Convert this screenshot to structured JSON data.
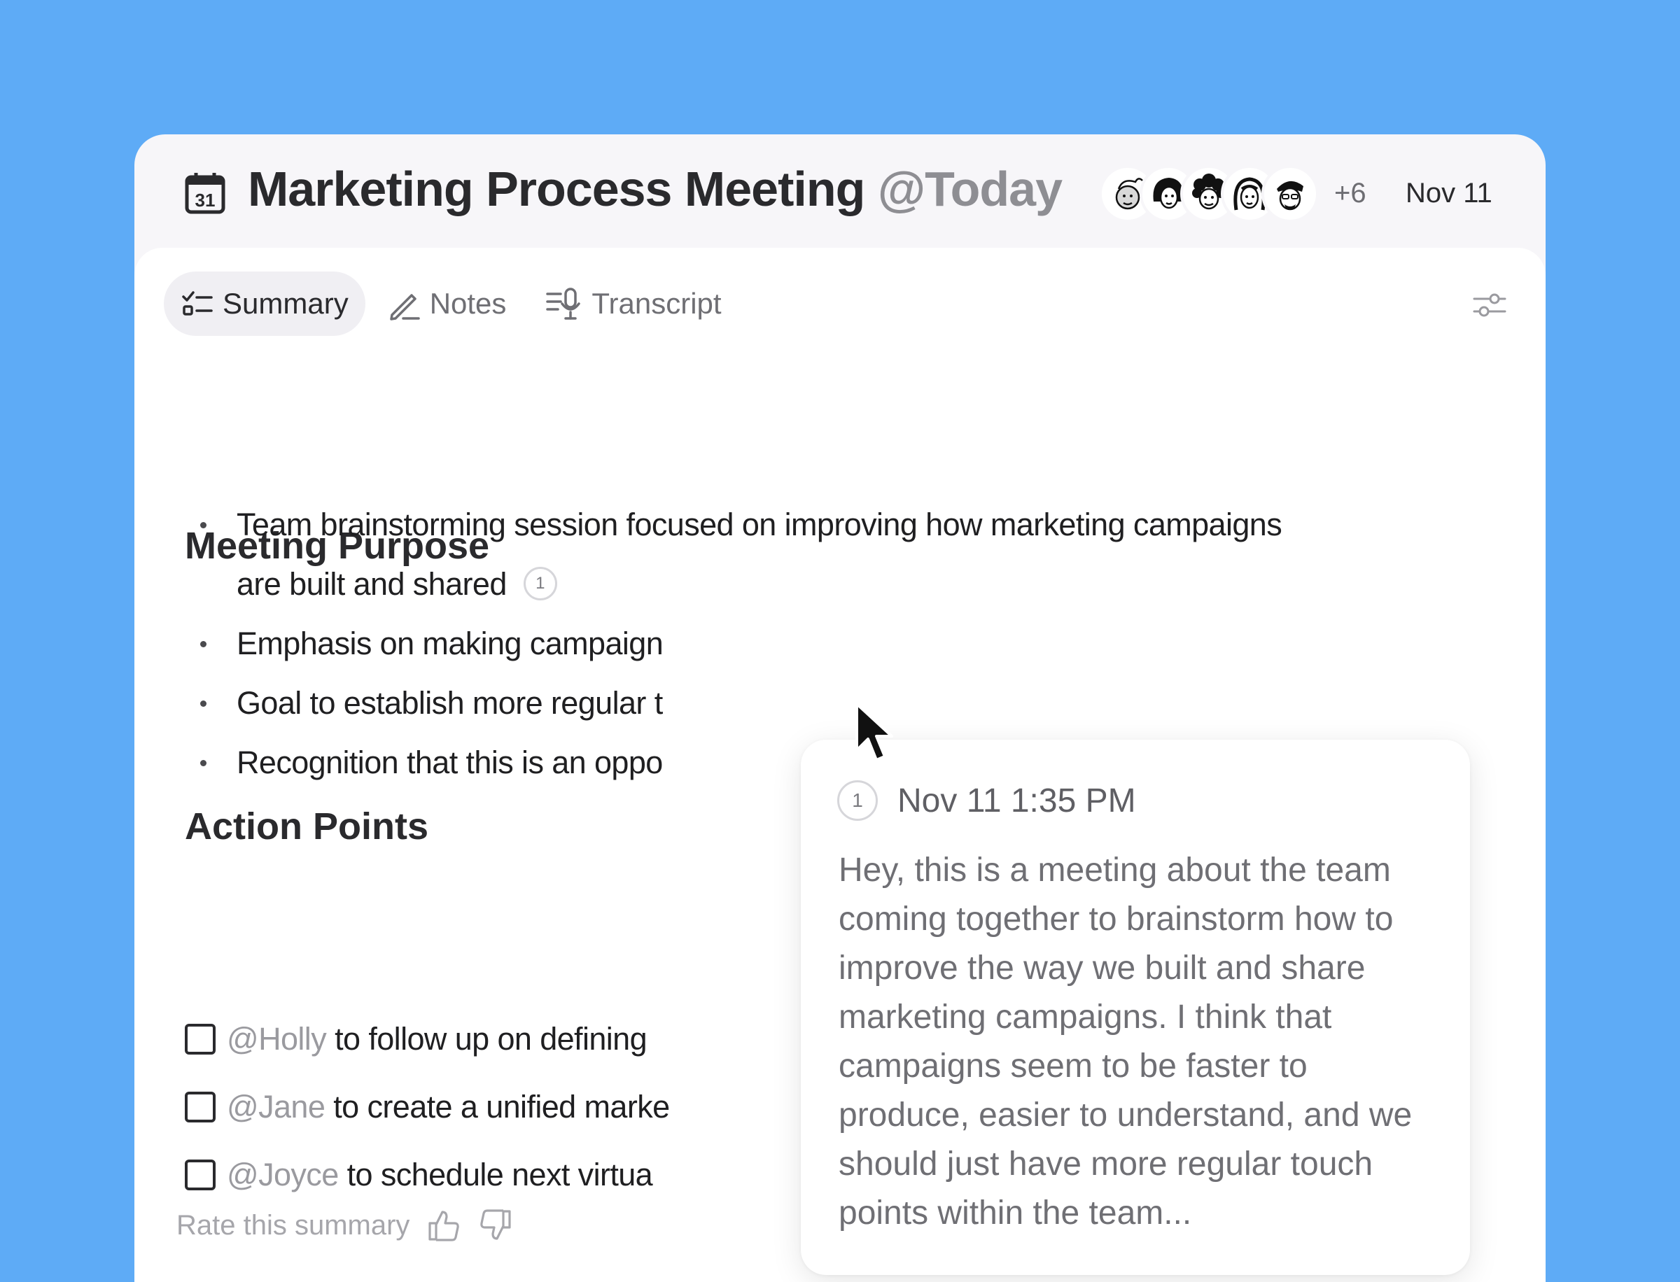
{
  "header": {
    "title": "Marketing Process Meeting",
    "title_suffix": "@Today",
    "calendar_day": "31",
    "more_participants": "+6",
    "date": "Nov 11"
  },
  "tabs": [
    {
      "label": "Summary",
      "icon": "checklist-icon",
      "active": true
    },
    {
      "label": "Notes",
      "icon": "pen-icon",
      "active": false
    },
    {
      "label": "Transcript",
      "icon": "transcript-mic-icon",
      "active": false
    }
  ],
  "purpose": {
    "heading": "Meeting Purpose",
    "items": [
      {
        "text": "Team brainstorming session focused on improving how marketing campaigns are built and shared",
        "citation": "1"
      },
      {
        "text": "Emphasis on making campaign"
      },
      {
        "text": "Goal to establish more regular t"
      },
      {
        "text": "Recognition that this is an oppo"
      }
    ]
  },
  "actions": {
    "heading": "Action Points",
    "items": [
      {
        "mention": "@Holly",
        "text": "to follow up on defining"
      },
      {
        "mention": "@Jane",
        "text": "to create a unified marke"
      },
      {
        "mention": "@Joyce",
        "text": "to schedule next virtua"
      }
    ]
  },
  "popover": {
    "citation": "1",
    "time": "Nov 11 1:35 PM",
    "text": "Hey, this is a meeting about the team coming together to brainstorm how to improve the way we built and share marketing campaigns. I think that campaigns seem to be faster to produce, easier to understand, and we should just have more regular touch points within the team..."
  },
  "feedback": {
    "label": "Rate this summary"
  },
  "colors": {
    "background": "#5eabf6",
    "header_bg": "#f7f6f9",
    "panel_bg": "#ffffff",
    "mention": "#9a9a9f"
  }
}
